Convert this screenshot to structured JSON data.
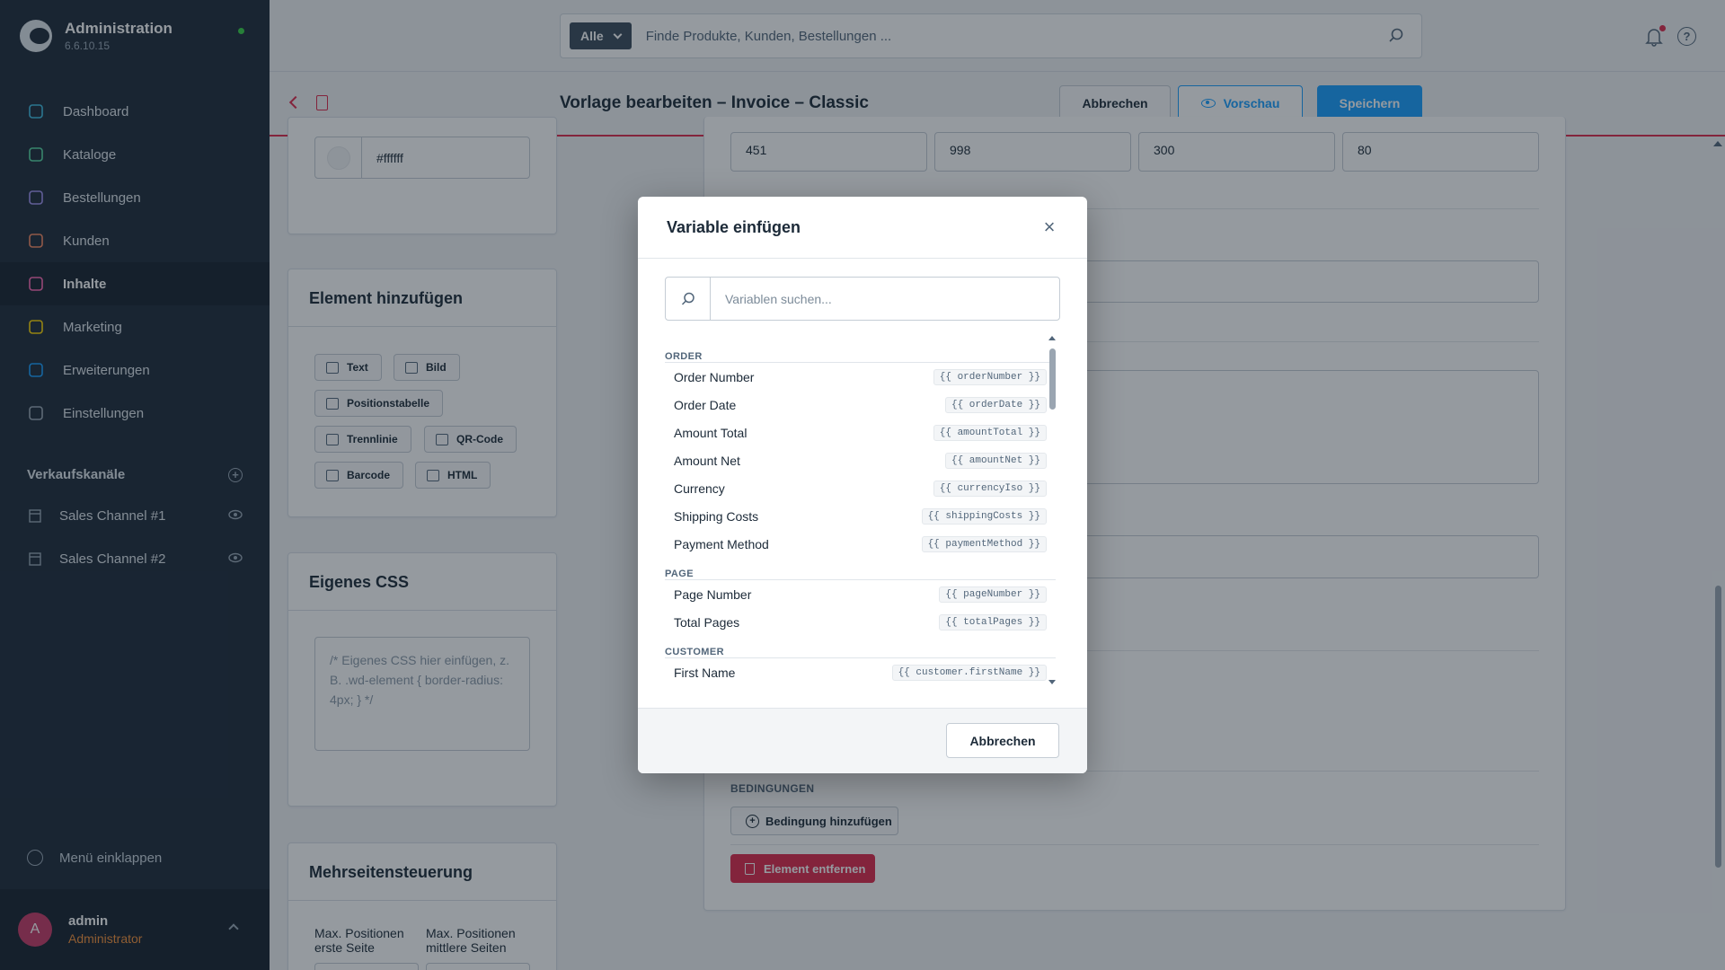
{
  "app": {
    "title": "Administration",
    "version": "6.6.10.15"
  },
  "sidebar": {
    "items": [
      {
        "label": "Dashboard",
        "icon": "dashboard-icon",
        "color": "#3ebee3"
      },
      {
        "label": "Kataloge",
        "icon": "catalog-icon",
        "color": "#57d9a3"
      },
      {
        "label": "Bestellungen",
        "icon": "bag-icon",
        "color": "#a092f0"
      },
      {
        "label": "Kunden",
        "icon": "users-icon",
        "color": "#f88962"
      },
      {
        "label": "Inhalte",
        "icon": "content-icon",
        "color": "#ff68b4"
      },
      {
        "label": "Marketing",
        "icon": "megaphone-icon",
        "color": "#ffd700"
      },
      {
        "label": "Erweiterungen",
        "icon": "plug-icon",
        "color": "#189eff"
      },
      {
        "label": "Einstellungen",
        "icon": "gear-icon",
        "color": "#9aa8b5"
      }
    ],
    "active_index": 4,
    "sales_channels_heading": "Verkaufskanäle",
    "sales_channels": [
      {
        "label": "Sales Channel #1"
      },
      {
        "label": "Sales Channel #2"
      }
    ],
    "collapse_label": "Menü einklappen",
    "user": {
      "initial": "A",
      "name": "admin",
      "role": "Administrator"
    }
  },
  "topbar": {
    "scope": "Alle",
    "search_placeholder": "Finde Produkte, Kunden, Bestellungen ..."
  },
  "smartbar": {
    "title": "Vorlage bearbeiten – Invoice – Classic",
    "cancel_label": "Abbrechen",
    "preview_label": "Vorschau",
    "save_label": "Speichern"
  },
  "editor": {
    "color_value": "#ffffff",
    "add_element_title": "Element hinzufügen",
    "element_buttons": [
      {
        "label": "Text",
        "icon": "text-icon"
      },
      {
        "label": "Bild",
        "icon": "image-icon"
      },
      {
        "label": "Positionstabelle",
        "icon": "table-icon"
      },
      {
        "label": "Trennlinie",
        "icon": "divider-icon"
      },
      {
        "label": "QR-Code",
        "icon": "qrcode-icon"
      },
      {
        "label": "Barcode",
        "icon": "barcode-icon"
      },
      {
        "label": "HTML",
        "icon": "html-icon"
      }
    ],
    "custom_css_title": "Eigenes CSS",
    "custom_css_placeholder": "/* Eigenes CSS hier einfügen, z. B. .wd-element { border-radius: 4px; } */",
    "multipage_title": "Mehrseitensteuerung",
    "max_first_label": "Max. Positionen erste Seite",
    "max_middle_label": "Max. Positionen mittlere Seiten",
    "position_values": [
      "451",
      "998",
      "300",
      "80"
    ],
    "conditions_label": "BEDINGUNGEN",
    "add_condition_label": "Bedingung hinzufügen",
    "remove_element_label": "Element entfernen"
  },
  "modal": {
    "title": "Variable einfügen",
    "search_placeholder": "Variablen suchen...",
    "groups": [
      {
        "name": "ORDER",
        "items": [
          {
            "label": "Order Number",
            "code": "{{ orderNumber }}"
          },
          {
            "label": "Order Date",
            "code": "{{ orderDate }}"
          },
          {
            "label": "Amount Total",
            "code": "{{ amountTotal }}"
          },
          {
            "label": "Amount Net",
            "code": "{{ amountNet }}"
          },
          {
            "label": "Currency",
            "code": "{{ currencyIso }}"
          },
          {
            "label": "Shipping Costs",
            "code": "{{ shippingCosts }}"
          },
          {
            "label": "Payment Method",
            "code": "{{ paymentMethod }}"
          }
        ]
      },
      {
        "name": "PAGE",
        "items": [
          {
            "label": "Page Number",
            "code": "{{ pageNumber }}"
          },
          {
            "label": "Total Pages",
            "code": "{{ totalPages }}"
          }
        ]
      },
      {
        "name": "CUSTOMER",
        "items": [
          {
            "label": "First Name",
            "code": "{{ customer.firstName }}"
          }
        ]
      }
    ],
    "cancel_label": "Abbrechen"
  }
}
